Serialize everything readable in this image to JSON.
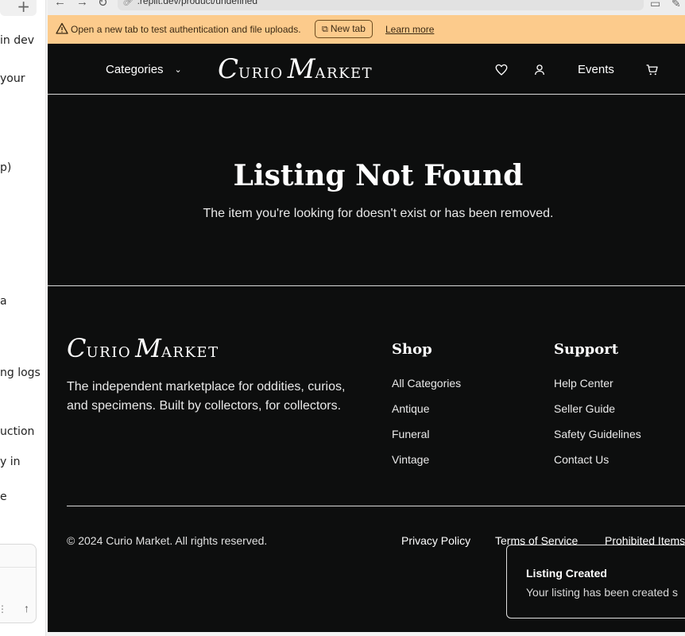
{
  "left_panel": {
    "new_button": "+",
    "fragments": [
      "in dev",
      "your",
      "p)",
      "a",
      "ng logs",
      "uction",
      "y in",
      "e"
    ]
  },
  "browser": {
    "url": ".replit.dev/product/undefined"
  },
  "banner": {
    "message": "Open a new tab to test authentication and file uploads.",
    "new_tab_label": "New tab",
    "learn_more_label": "Learn more"
  },
  "header": {
    "categories_label": "Categories",
    "logo_first_initial": "C",
    "logo_first_rest": "URIO",
    "logo_second_initial": "M",
    "logo_second_rest": "ARKET",
    "events_label": "Events"
  },
  "main": {
    "title": "Listing Not Found",
    "message": "The item you're looking for doesn't exist or has been removed."
  },
  "footer": {
    "tagline": "The independent marketplace for oddities, curios, and specimens. Built by collectors, for collectors.",
    "shop_heading": "Shop",
    "shop_links": [
      "All Categories",
      "Antique",
      "Funeral",
      "Vintage"
    ],
    "support_heading": "Support",
    "support_links": [
      "Help Center",
      "Seller Guide",
      "Safety Guidelines",
      "Contact Us"
    ],
    "copyright": "© 2024 Curio Market. All rights reserved.",
    "legal_links": [
      "Privacy Policy",
      "Terms of Service",
      "Prohibited Items"
    ]
  },
  "toast": {
    "title": "Listing Created",
    "message": "Your listing has been created s"
  },
  "colors": {
    "site_bg": "#0d0e0e",
    "banner_bg": "#fccb8c",
    "text": "#ffffff"
  }
}
